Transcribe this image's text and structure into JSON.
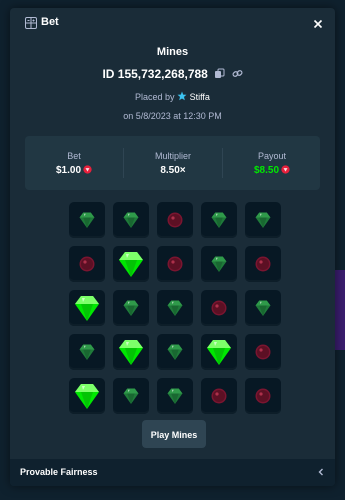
{
  "modal": {
    "title": "Bet",
    "title_icon": "bet-slip-icon",
    "close_icon": "close-icon"
  },
  "bet": {
    "game": "Mines",
    "id": "ID 155,732,268,788",
    "copy_icon": "copy-icon",
    "link_icon": "link-icon",
    "placed_by_prefix": "Placed by",
    "user_icon": "vip-star-icon",
    "user": "Stiffa",
    "date": "on 5/8/2023 at 12:30 PM"
  },
  "stats": {
    "bet_label": "Bet",
    "bet_value": "$1.00",
    "multiplier_label": "Multiplier",
    "multiplier_value": "8.50×",
    "payout_label": "Payout",
    "payout_value": "$8.50",
    "currency_icon": "ruby-coin-icon"
  },
  "grid": {
    "legend": {
      "g": "gem-dim",
      "G": "gem-revealed",
      "m": "mine-dim"
    },
    "rows": [
      [
        "g",
        "g",
        "m",
        "g",
        "g"
      ],
      [
        "m",
        "G",
        "m",
        "g",
        "m"
      ],
      [
        "G",
        "g",
        "g",
        "m",
        "g"
      ],
      [
        "g",
        "G",
        "g",
        "G",
        "m"
      ],
      [
        "G",
        "g",
        "g",
        "m",
        "m"
      ]
    ]
  },
  "actions": {
    "play_label": "Play Mines"
  },
  "footer": {
    "label": "Provable Fairness",
    "chevron_icon": "chevron-left-icon"
  },
  "colors": {
    "background": "#0f212e",
    "modal": "#1a2c38",
    "panel": "#213743",
    "tile": "#071824",
    "button": "#2f4553",
    "muted_text": "#b1bad3",
    "payout_green": "#00e701",
    "gem_bright": "#00e701",
    "gem_dim": "#1f7a3a",
    "mine": "#7a1530"
  }
}
